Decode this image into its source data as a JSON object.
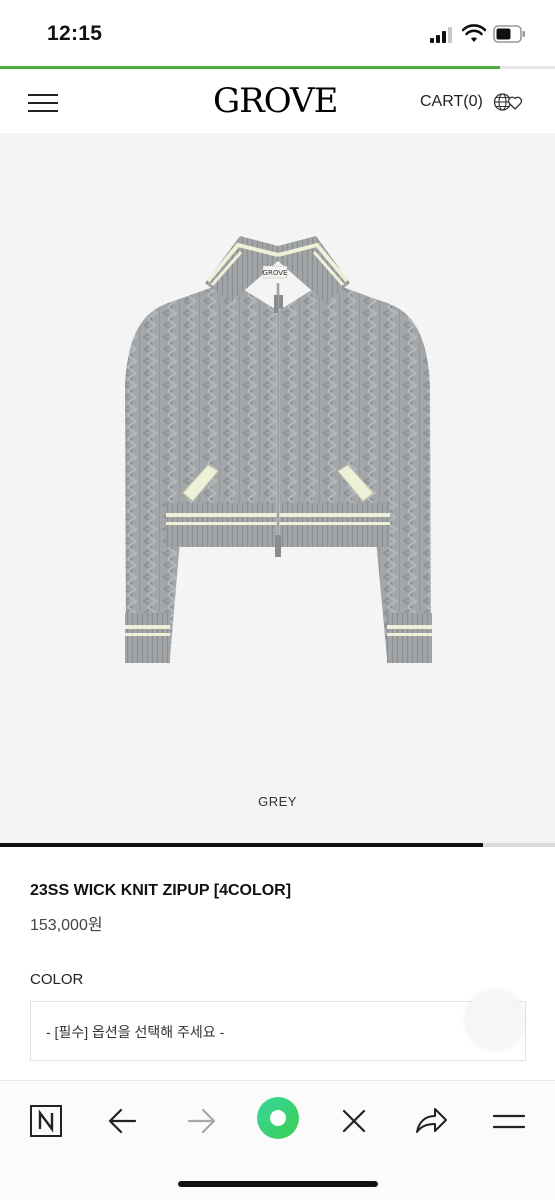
{
  "status_bar": {
    "time": "12:15"
  },
  "page_load_progress": 0.9,
  "header": {
    "logo": "GROVE",
    "cart_label": "CART(0)",
    "globe_icon": "globe-heart-icon"
  },
  "product": {
    "image_caption": "GREY",
    "image_slider_progress": 0.87,
    "name": "23SS WICK KNIT ZIPUP [4COLOR]",
    "price": "153,000원"
  },
  "option": {
    "label": "COLOR",
    "placeholder": "- [필수] 옵션을 선택해 주세요 -"
  },
  "browser_toolbar": {
    "items": [
      "naver-icon",
      "back-arrow-icon",
      "forward-arrow-icon",
      "green-dot-icon",
      "close-icon",
      "share-icon",
      "menu-icon"
    ]
  },
  "colors": {
    "accent_green": "#4caf3c",
    "sweater_grey": "#a4a7a9",
    "cream_trim": "#eef0d8"
  }
}
